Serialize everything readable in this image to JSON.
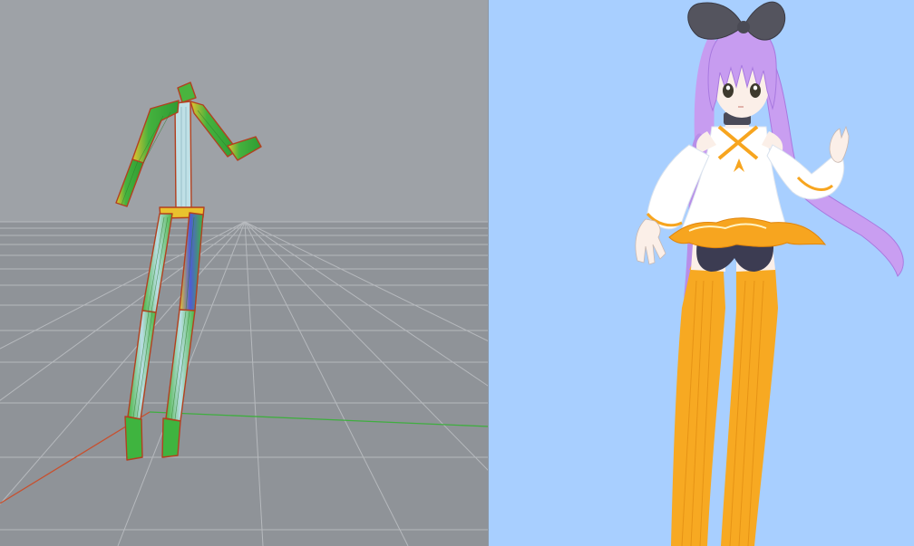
{
  "left_viewport": {
    "view": "skeleton-rig-view",
    "background_color": "#9ea2a7",
    "floor_color": "#8f9398",
    "grid_color": "#c6c9cd",
    "x_axis_color": "#c8502e",
    "z_axis_color": "#3fae3f",
    "bone_colors": {
      "green": "#3fb43f",
      "yellow": "#f2c12a",
      "blue": "#4f5bd6",
      "outline": "#b3401f"
    }
  },
  "right_viewport": {
    "view": "character-render-view",
    "background_color": "#a8cfff",
    "colors": {
      "hair": "#c79cf0",
      "bow": "#54545e",
      "skin": "#fbefe8",
      "dress": "#ffffff",
      "trim": "#f7a51f",
      "stockings": "#f7a922",
      "shorts": "#3c3c52"
    }
  }
}
